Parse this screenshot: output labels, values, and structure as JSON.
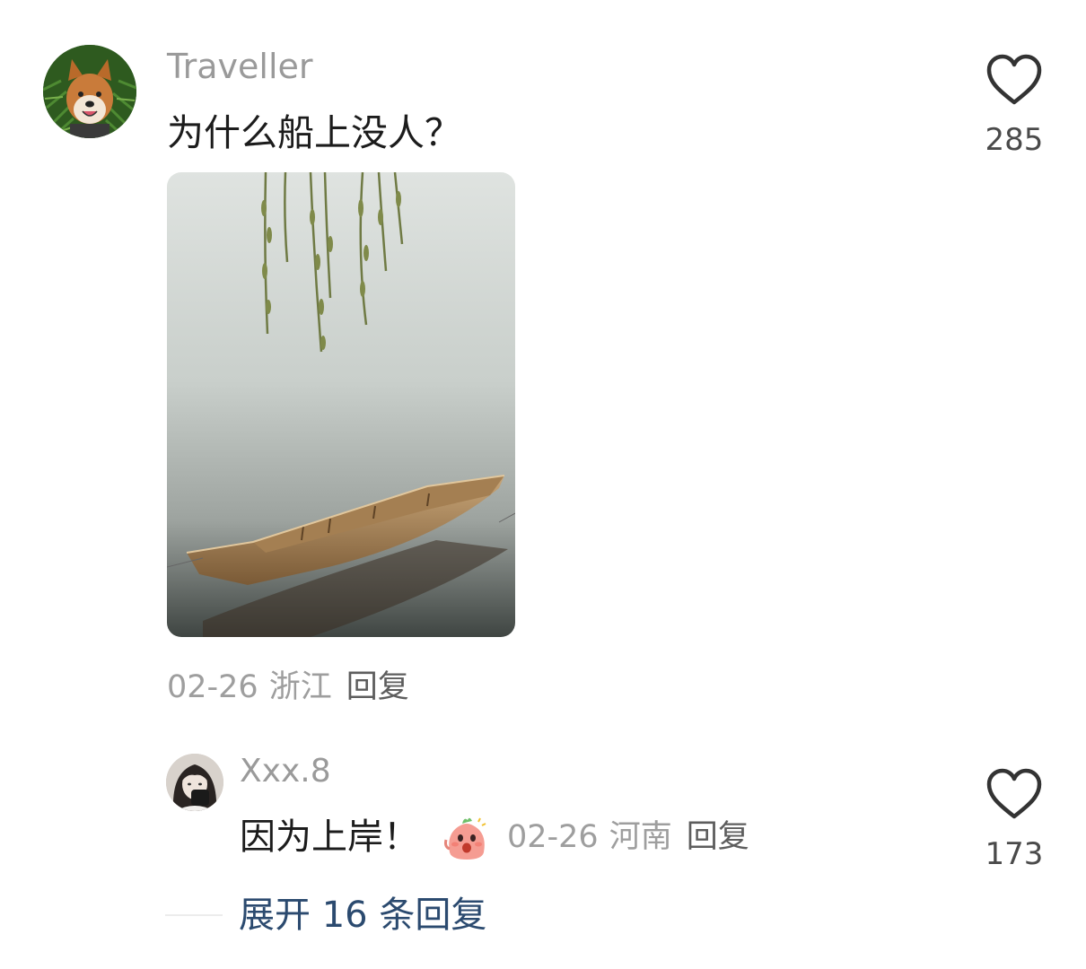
{
  "main_comment": {
    "username": "Traveller",
    "text": "为什么船上没人？",
    "date": "02-26",
    "location": "浙江",
    "reply_label": "回复",
    "like_count": "285",
    "avatar_icon": "shiba-dog-avatar",
    "image_subject": "photo-wooden-boat-under-willow"
  },
  "reply_comment": {
    "username": "Xxx.8",
    "text": "因为上岸！",
    "emoji_icon": "pink-blob-emoji",
    "date": "02-26",
    "location": "河南",
    "reply_label": "回复",
    "like_count": "173",
    "avatar_icon": "girl-portrait-avatar"
  },
  "expand": {
    "label": "展开 16 条回复"
  },
  "colors": {
    "username": "#9a9a9a",
    "body_text": "#1c1c1c",
    "meta": "#9e9e9e",
    "reply_button": "#5d5d5d",
    "expand_link": "#2b4a6f"
  }
}
